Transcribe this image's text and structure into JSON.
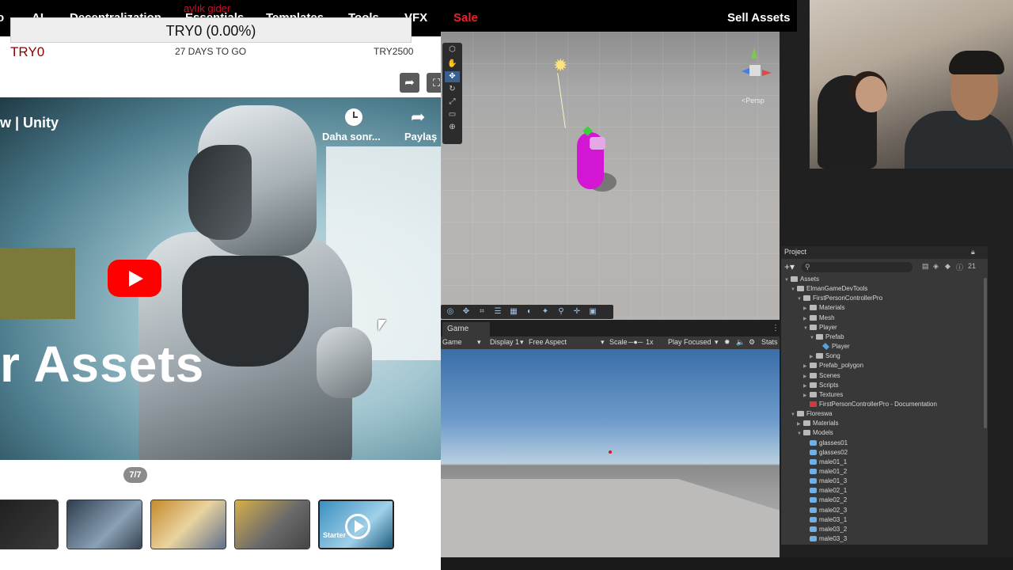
{
  "web": {
    "nav": [
      "o",
      "AI",
      "Decentralization",
      "Essentials",
      "Templates",
      "Tools",
      "VFX"
    ],
    "overlay_text": "aylık gider",
    "price_pill": "TRY0 (0.00%)",
    "sale_row": {
      "current": "TRY0",
      "days": "27 DAYS TO GO",
      "original": "TRY2500"
    },
    "video": {
      "title": "w | Unity",
      "watch_later": "Daha sonr...",
      "share": "Paylaş",
      "big_text": "r Assets"
    },
    "gallery": {
      "page": "7/7",
      "active_thumb_label": "Starter"
    }
  },
  "store_bar": {
    "sale": "Sale",
    "sell": "Sell Assets"
  },
  "scene": {
    "persp": "<Persp"
  },
  "game": {
    "tab": "Game",
    "options": {
      "view": "Game",
      "display": "Display 1",
      "aspect": "Free Aspect",
      "scale_label": "Scale",
      "scale_value": "1x",
      "play_focus": "Play Focused",
      "stats": "Stats"
    }
  },
  "project": {
    "tab": "Project",
    "tree": [
      {
        "label": "Assets",
        "depth": 0,
        "icon": "folder",
        "open": true
      },
      {
        "label": "ElmanGameDevTools",
        "depth": 1,
        "icon": "folder",
        "open": true
      },
      {
        "label": "FirstPersonControllerPro",
        "depth": 2,
        "icon": "folder",
        "open": true
      },
      {
        "label": "Materials",
        "depth": 3,
        "icon": "folder"
      },
      {
        "label": "Mesh",
        "depth": 3,
        "icon": "folder"
      },
      {
        "label": "Player",
        "depth": 3,
        "icon": "folder",
        "open": true
      },
      {
        "label": "Prefab",
        "depth": 4,
        "icon": "folder",
        "open": true
      },
      {
        "label": "Player",
        "depth": 5,
        "icon": "prefab"
      },
      {
        "label": "Song",
        "depth": 4,
        "icon": "folder"
      },
      {
        "label": "Prefab_polygon",
        "depth": 3,
        "icon": "folder"
      },
      {
        "label": "Scenes",
        "depth": 3,
        "icon": "folder"
      },
      {
        "label": "Scripts",
        "depth": 3,
        "icon": "folder"
      },
      {
        "label": "Textures",
        "depth": 3,
        "icon": "folder"
      },
      {
        "label": "FirstPersonControllerPro - Documentation",
        "depth": 3,
        "icon": "doc"
      },
      {
        "label": "Floreswa",
        "depth": 1,
        "icon": "folder",
        "open": true
      },
      {
        "label": "Materials",
        "depth": 2,
        "icon": "folder"
      },
      {
        "label": "Models",
        "depth": 2,
        "icon": "folder",
        "open": true
      },
      {
        "label": "glasses01",
        "depth": 3,
        "icon": "model"
      },
      {
        "label": "glasses02",
        "depth": 3,
        "icon": "model"
      },
      {
        "label": "male01_1",
        "depth": 3,
        "icon": "model"
      },
      {
        "label": "male01_2",
        "depth": 3,
        "icon": "model"
      },
      {
        "label": "male01_3",
        "depth": 3,
        "icon": "model"
      },
      {
        "label": "male02_1",
        "depth": 3,
        "icon": "model"
      },
      {
        "label": "male02_2",
        "depth": 3,
        "icon": "model"
      },
      {
        "label": "male02_3",
        "depth": 3,
        "icon": "model"
      },
      {
        "label": "male03_1",
        "depth": 3,
        "icon": "model"
      },
      {
        "label": "male03_2",
        "depth": 3,
        "icon": "model"
      },
      {
        "label": "male03_3",
        "depth": 3,
        "icon": "model"
      }
    ],
    "visible_count": "21"
  },
  "colors": {
    "sale_red": "#e8222e",
    "unity_panel": "#383838",
    "capsule": "#d316d3",
    "youtube_red": "#ff0000"
  }
}
